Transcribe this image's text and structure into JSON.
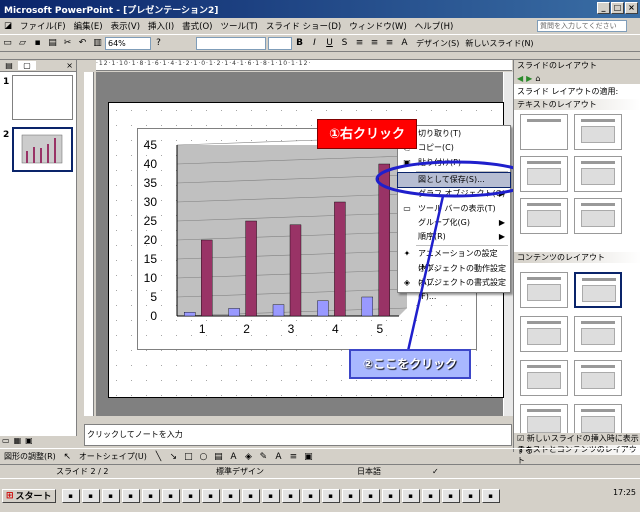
{
  "window": {
    "title": "Microsoft PowerPoint - [プレゼンテーション2]"
  },
  "menu": {
    "items": [
      "ファイル(F)",
      "編集(E)",
      "表示(V)",
      "挿入(I)",
      "書式(O)",
      "ツール(T)",
      "スライド ショー(D)",
      "ウィンドウ(W)",
      "ヘルプ(H)"
    ],
    "question_placeholder": "質問を入力してください"
  },
  "toolbar": {
    "zoom": "64%",
    "design_label": "デザイン(S)",
    "new_slide_label": "新しいスライド(N)"
  },
  "slides_panel": {
    "numbers": [
      "1",
      "2"
    ]
  },
  "chart_data": {
    "type": "bar",
    "categories": [
      "1",
      "2",
      "3",
      "4",
      "5"
    ],
    "y_ticks": [
      "0",
      "5",
      "10",
      "15",
      "20",
      "25",
      "30",
      "35",
      "40",
      "45"
    ],
    "ylim": [
      0,
      45
    ],
    "series": [
      {
        "values": [
          1,
          2,
          3,
          4,
          5
        ],
        "color": "#9999ff"
      },
      {
        "values": [
          20,
          25,
          24,
          30,
          40
        ],
        "color": "#993366"
      }
    ]
  },
  "context_menu": {
    "items": [
      {
        "label": "切り取り(T)",
        "icon": "scissors-icon"
      },
      {
        "label": "コピー(C)",
        "icon": "copy-icon"
      },
      {
        "label": "貼り付け(P)",
        "icon": "paste-icon"
      },
      {
        "label": "図として保存(S)...",
        "icon": "",
        "highlighted": true
      },
      {
        "label": "グラフ オブジェクト(O)",
        "icon": "",
        "submenu": true
      },
      {
        "label": "ツール バーの表示(T)",
        "icon": "toolbar-icon"
      },
      {
        "label": "グループ化(G)",
        "icon": "",
        "submenu": true
      },
      {
        "label": "順序(R)",
        "icon": "",
        "submenu": true
      },
      {
        "label": "アニメーションの設定(M)...",
        "icon": "animation-icon"
      },
      {
        "label": "オブジェクトの動作設定(A)...",
        "icon": ""
      },
      {
        "label": "オブジェクトの書式設定(F)...",
        "icon": "format-icon"
      }
    ]
  },
  "callouts": {
    "right_click": "①右クリック",
    "click_here": "②ここをクリック"
  },
  "task_pane": {
    "title": "スライドのレイアウト",
    "apply_label": "スライド レイアウトの適用:",
    "sections": [
      "テキストのレイアウト",
      "コンテンツのレイアウト",
      "テキストとコンテンツのレイアウト"
    ],
    "checkbox_label": "新しいスライドの挿入時に表示する"
  },
  "notes": {
    "placeholder": "クリックしてノートを入力"
  },
  "drawing_toolbar": {
    "draw_label": "図形の調整(R)",
    "autoshape_label": "オートシェイプ(U)"
  },
  "status": {
    "slide": "スライド 2 / 2",
    "design": "標準デザイン",
    "language": "日本語"
  },
  "taskbar": {
    "start": "スタート",
    "clock": "17:25"
  }
}
